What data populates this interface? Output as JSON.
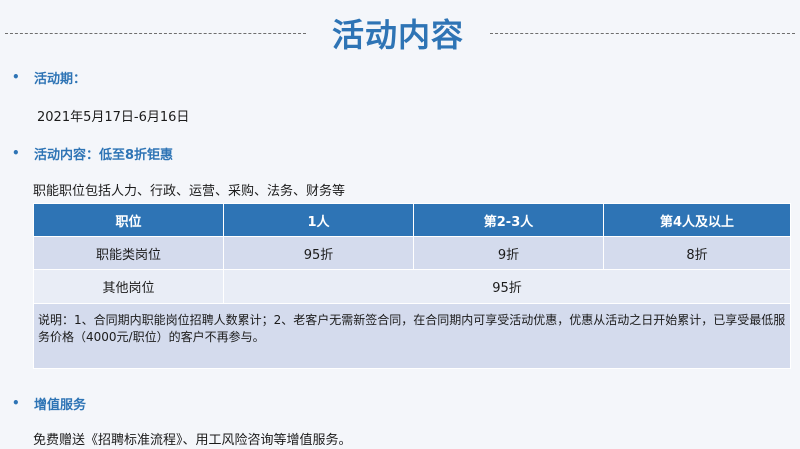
{
  "header": {
    "title": "活动内容"
  },
  "sections": {
    "period": {
      "bullet": "•",
      "heading": "活动期：",
      "value": "2021年5月17日-6月16日"
    },
    "content": {
      "bullet": "•",
      "heading": "活动内容：低至8折钜惠",
      "description": "职能职位包括人力、行政、运营、采购、法务、财务等"
    },
    "value_added": {
      "bullet": "•",
      "heading": "增值服务",
      "description": "免费赠送《招聘标准流程》、用工风险咨询等增值服务。"
    }
  },
  "pricing_table": {
    "headers": [
      "职位",
      "1人",
      "第2-3人",
      "第4人及以上"
    ],
    "rows": [
      {
        "position": "职能类岗位",
        "tier1": "95折",
        "tier2": "9折",
        "tier3": "8折"
      },
      {
        "position": "其他岗位",
        "all_tiers": "95折"
      }
    ],
    "note": "说明：1、合同期内职能岗位招聘人数累计；2、老客户无需新签合同，在合同期内可享受活动优惠，优惠从活动之日开始累计，已享受最低服务价格（4000元/职位）的客户不再参与。"
  },
  "colors": {
    "accent": "#2e74b5",
    "table_header": "#2e74b5",
    "table_row_dark": "#d4dbed",
    "table_row_light": "#e9edf6",
    "background": "#f4f6fa"
  }
}
